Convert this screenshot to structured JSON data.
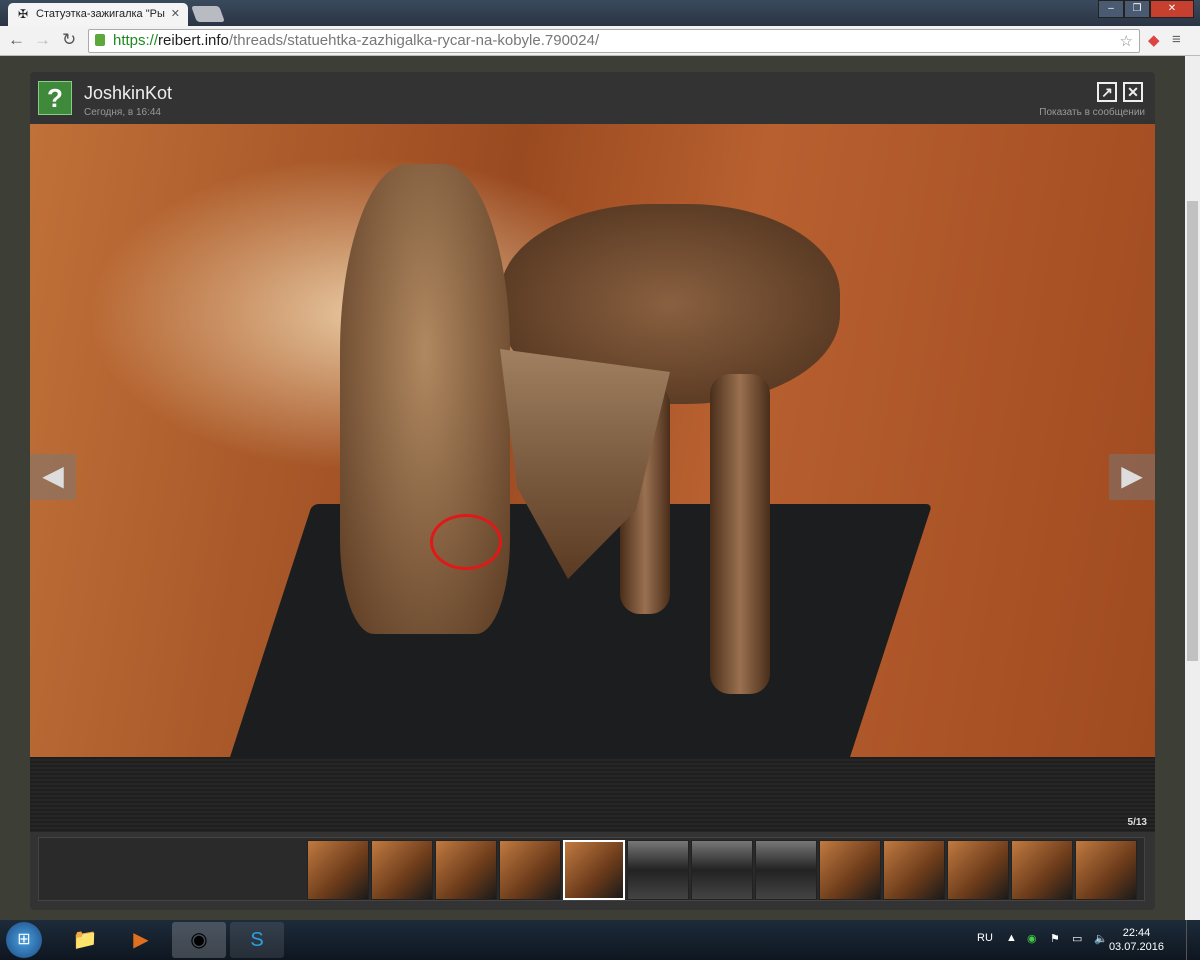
{
  "browser": {
    "tab_title": "Статуэтка-зажигалка \"Ры",
    "url_scheme": "https://",
    "url_host": "reibert.info",
    "url_path": "/threads/statuehtka-zazhigalka-rycar-na-kobyle.790024/"
  },
  "lightbox": {
    "username": "JoshkinKot",
    "time": "Сегодня, в 16:44",
    "show_in_message": "Показать в сообщении",
    "counter": "5/13",
    "total_images": 13,
    "active_index": 5
  },
  "taskbar": {
    "lang": "RU",
    "time": "22:44",
    "date": "03.07.2016"
  }
}
